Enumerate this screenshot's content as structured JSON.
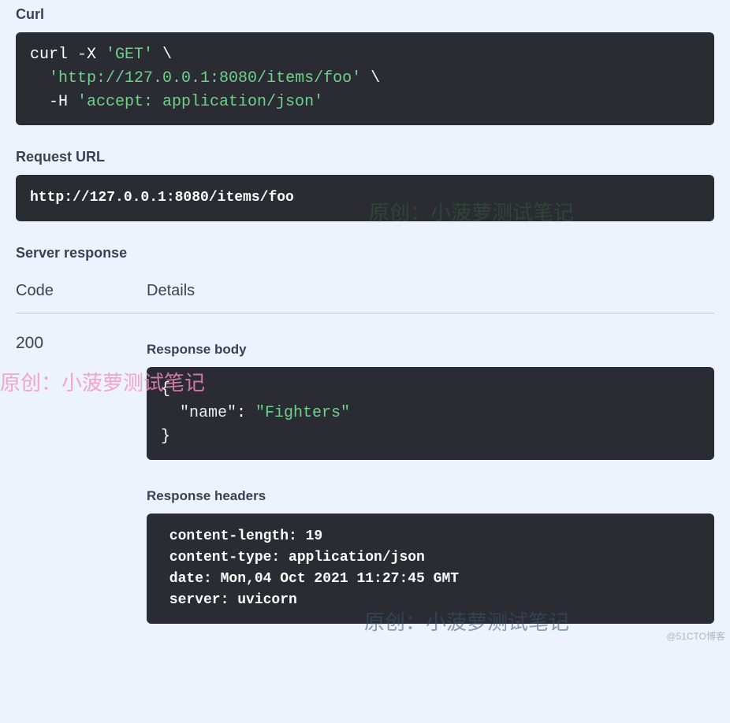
{
  "sections": {
    "curl_label": "Curl",
    "request_url_label": "Request URL",
    "server_response_label": "Server response",
    "code_col": "Code",
    "details_col": "Details",
    "response_body_label": "Response body",
    "response_headers_label": "Response headers"
  },
  "curl": {
    "cmd_line1_a": "curl -X ",
    "cmd_line1_b": "'GET'",
    "cmd_line1_c": " \\",
    "cmd_line2_a": "  ",
    "cmd_line2_b": "'http://127.0.0.1:8080/items/foo'",
    "cmd_line2_c": " \\",
    "cmd_line3_a": "  -H ",
    "cmd_line3_b": "'accept: application/json'"
  },
  "request_url": "http://127.0.0.1:8080/items/foo",
  "response": {
    "status_code": "200",
    "body_line1": "{",
    "body_line2_key": "  \"name\"",
    "body_line2_colon": ": ",
    "body_line2_val": "\"Fighters\"",
    "body_line3": "}",
    "headers": " content-length: 19 \n content-type: application/json \n date: Mon,04 Oct 2021 11:27:45 GMT \n server: uvicorn "
  },
  "watermarks": {
    "text": "原创：小菠萝测试笔记",
    "blog": "@51CTO博客"
  }
}
